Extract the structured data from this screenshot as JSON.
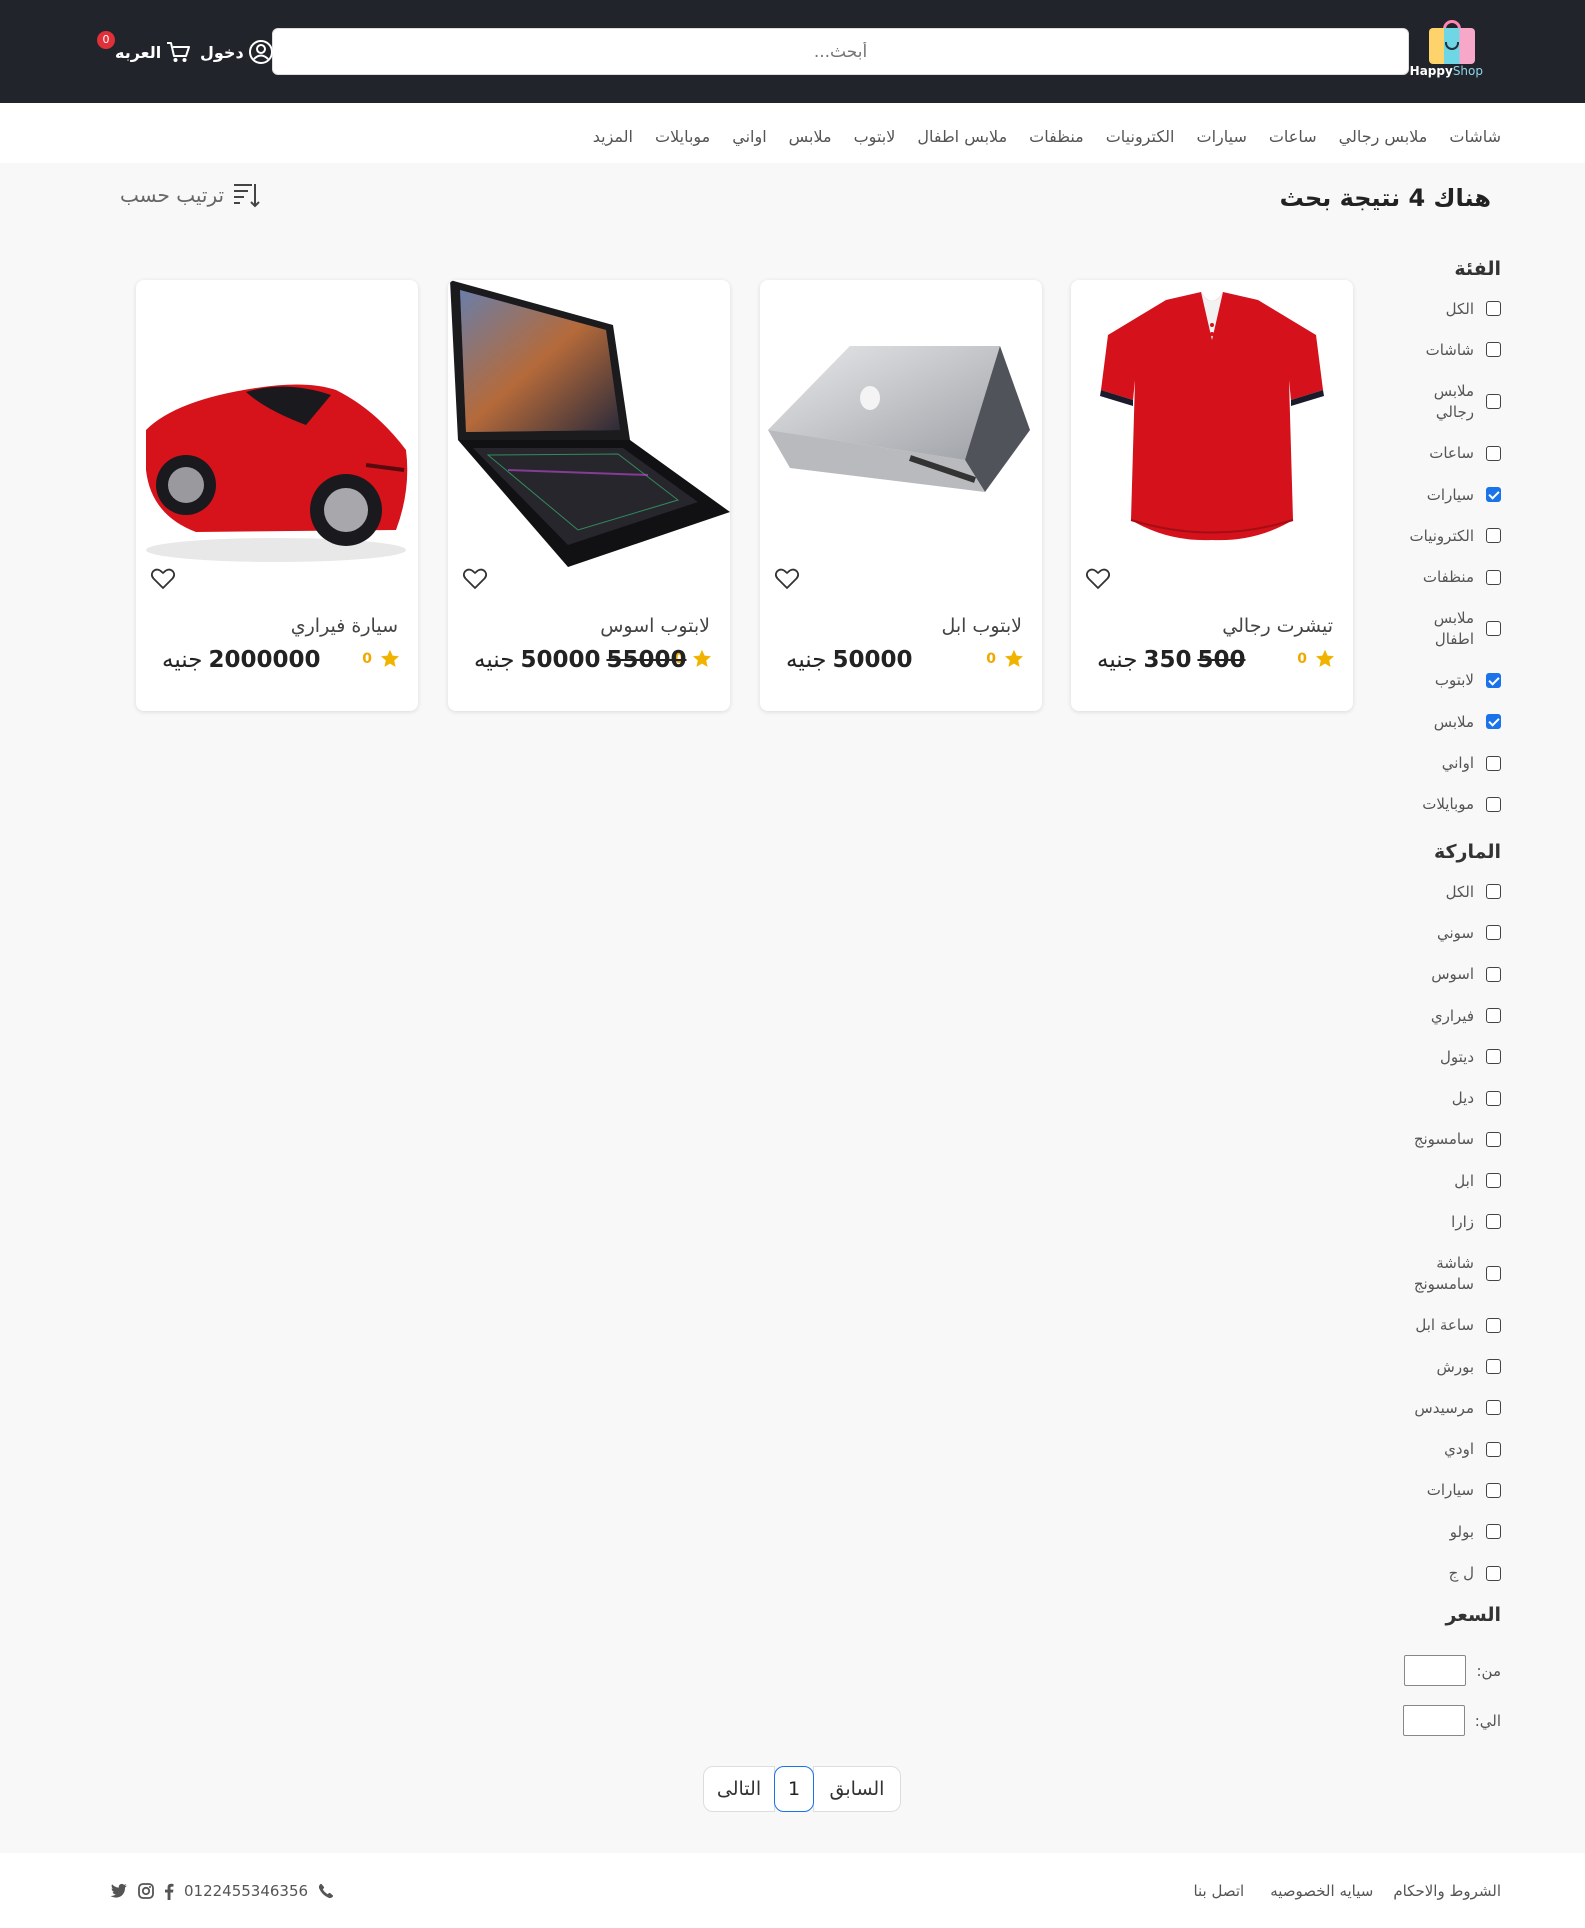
{
  "header": {
    "logo_brand": "Happy",
    "logo_suffix": "Shop",
    "search_placeholder": "أبحث...",
    "login_label": "دخول",
    "cart_label": "العربه",
    "cart_count": "0"
  },
  "nav": {
    "categories": [
      "شاشات",
      "ملابس رجالي",
      "ساعات",
      "سيارات",
      "الكترونيات",
      "منظفات",
      "ملابس اطفال",
      "لابتوب",
      "ملابس",
      "اواني",
      "موبايلات",
      "المزيد"
    ]
  },
  "results": {
    "title": "هناك 4 نتيجة بحث",
    "sort_label": "ترتيب حسب"
  },
  "filters": {
    "category_heading": "الفئة",
    "categories": [
      {
        "label": "الكل",
        "checked": false
      },
      {
        "label": "شاشات",
        "checked": false
      },
      {
        "label": "ملابس رجالي",
        "checked": false
      },
      {
        "label": "ساعات",
        "checked": false
      },
      {
        "label": "سيارات",
        "checked": true
      },
      {
        "label": "الكترونيات",
        "checked": false
      },
      {
        "label": "منظفات",
        "checked": false
      },
      {
        "label": "ملابس اطفال",
        "checked": false
      },
      {
        "label": "لابتوب",
        "checked": true
      },
      {
        "label": "ملابس",
        "checked": true
      },
      {
        "label": "اواني",
        "checked": false
      },
      {
        "label": "موبايلات",
        "checked": false
      }
    ],
    "brand_heading": "الماركة",
    "brands": [
      {
        "label": "الكل",
        "checked": false
      },
      {
        "label": "سوني",
        "checked": false
      },
      {
        "label": "اسوس",
        "checked": false
      },
      {
        "label": "فيراري",
        "checked": false
      },
      {
        "label": "ديتول",
        "checked": false
      },
      {
        "label": "ديل",
        "checked": false
      },
      {
        "label": "سامسونج",
        "checked": false
      },
      {
        "label": "ابل",
        "checked": false
      },
      {
        "label": "زارا",
        "checked": false
      },
      {
        "label": "شاشة سامسونج",
        "checked": false
      },
      {
        "label": "ساعة ابل",
        "checked": false
      },
      {
        "label": "بورش",
        "checked": false
      },
      {
        "label": "مرسيدس",
        "checked": false
      },
      {
        "label": "اودي",
        "checked": false
      },
      {
        "label": "سيارات",
        "checked": false
      },
      {
        "label": "بولو",
        "checked": false
      },
      {
        "label": "ل ج",
        "checked": false
      }
    ],
    "price_heading": "السعر",
    "price_from_label": "من:",
    "price_to_label": "الي:"
  },
  "products": [
    {
      "name": "تيشرت رجالي",
      "rating": "0",
      "price": "350",
      "old_price": "500",
      "currency": "جنيه",
      "image": "red-shirt"
    },
    {
      "name": "لابتوب ابل",
      "rating": "0",
      "price": "50000",
      "old_price": "",
      "currency": "جنيه",
      "image": "macbook"
    },
    {
      "name": "لابتوب اسوس",
      "rating": "0",
      "price": "50000",
      "old_price": "55000",
      "currency": "جنيه",
      "image": "asus-laptop"
    },
    {
      "name": "سيارة فيراري",
      "rating": "0",
      "price": "2000000",
      "old_price": "",
      "currency": "جنيه",
      "image": "red-ferrari"
    }
  ],
  "pagination": {
    "prev_label": "السابق",
    "page": "1",
    "next_label": "التالى"
  },
  "footer": {
    "links": [
      "الشروط والاحكام",
      "سيايه الخصوصيه",
      "اتصل بنا"
    ],
    "phone": "0122455346356"
  },
  "colors": {
    "header_bg": "#21252b",
    "accent": "#1a73e8",
    "star": "#f0b400",
    "badge": "#e0303a"
  }
}
